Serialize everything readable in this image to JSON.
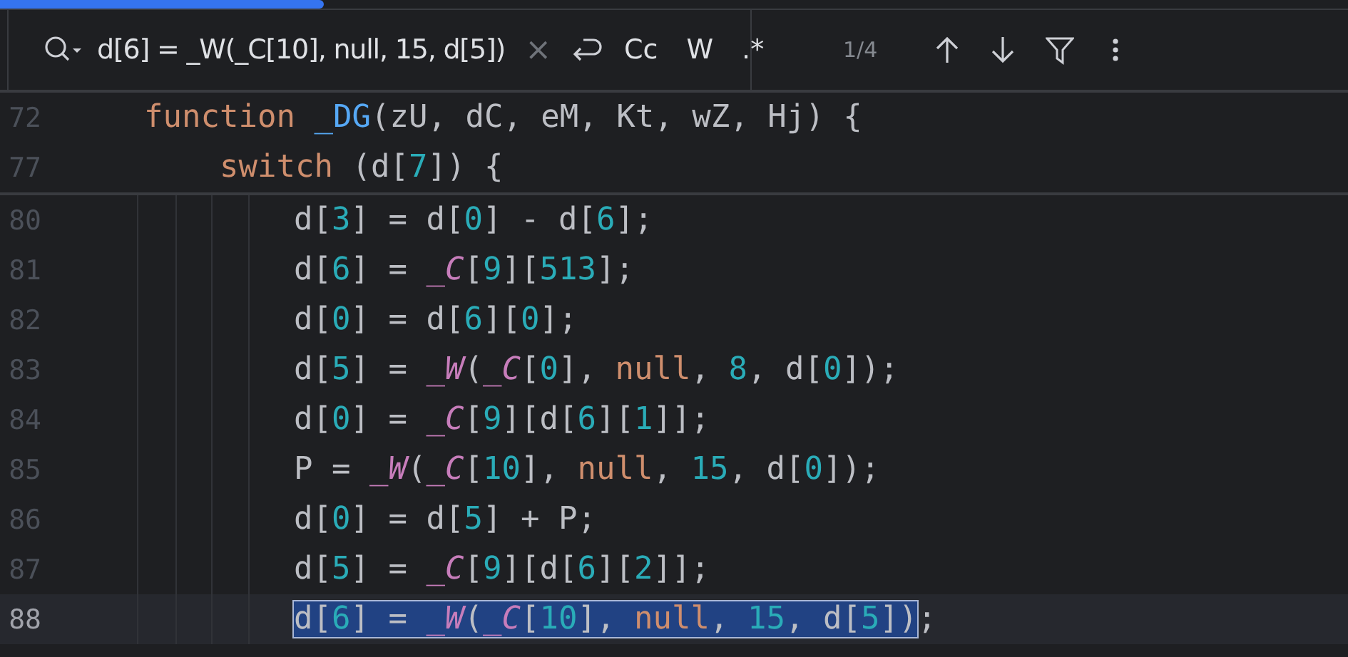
{
  "progress": {
    "level": 0.24
  },
  "search": {
    "query": "d[6] = _W(_C[10], null, 15, d[5])",
    "clear": "×",
    "options": [
      {
        "label": "Cc",
        "selected": false
      },
      {
        "label": "W",
        "selected": false
      },
      {
        "label": ".*",
        "selected": false
      }
    ],
    "count": "1/4"
  },
  "sticky_lines": [
    {
      "number": "72",
      "tokens": [
        {
          "kind": "keyword",
          "text": "function "
        },
        {
          "kind": "fn",
          "text": "_DG"
        },
        {
          "kind": "text",
          "text": "(zU, dC, eM, Kt, wZ, Hj) {"
        }
      ],
      "children": [
        {
          "number": "77",
          "tokens": [
            {
              "kind": "keyword",
              "text": "switch "
            },
            {
              "kind": "text",
              "text": "(d["
            },
            {
              "kind": "num",
              "text": "7"
            },
            {
              "kind": "text",
              "text": "]) {"
            }
          ]
        }
      ]
    }
  ],
  "lines": [
    {
      "number": "80",
      "current": false,
      "tokens": [
        {
          "kind": "text",
          "text": "d["
        },
        {
          "kind": "num",
          "text": "3"
        },
        {
          "kind": "text",
          "text": "] = d["
        },
        {
          "kind": "num",
          "text": "0"
        },
        {
          "kind": "text",
          "text": "] - d["
        },
        {
          "kind": "num",
          "text": "6"
        },
        {
          "kind": "text",
          "text": "];"
        }
      ]
    },
    {
      "number": "81",
      "current": false,
      "tokens": [
        {
          "kind": "text",
          "text": "d["
        },
        {
          "kind": "num",
          "text": "6"
        },
        {
          "kind": "text",
          "text": "] = "
        },
        {
          "kind": "global",
          "text": "_C"
        },
        {
          "kind": "text",
          "text": "["
        },
        {
          "kind": "num",
          "text": "9"
        },
        {
          "kind": "text",
          "text": "]["
        },
        {
          "kind": "num",
          "text": "513"
        },
        {
          "kind": "text",
          "text": "];"
        }
      ]
    },
    {
      "number": "82",
      "current": false,
      "tokens": [
        {
          "kind": "text",
          "text": "d["
        },
        {
          "kind": "num",
          "text": "0"
        },
        {
          "kind": "text",
          "text": "] = d["
        },
        {
          "kind": "num",
          "text": "6"
        },
        {
          "kind": "text",
          "text": "]["
        },
        {
          "kind": "num",
          "text": "0"
        },
        {
          "kind": "text",
          "text": "];"
        }
      ]
    },
    {
      "number": "83",
      "current": false,
      "tokens": [
        {
          "kind": "text",
          "text": "d["
        },
        {
          "kind": "num",
          "text": "5"
        },
        {
          "kind": "text",
          "text": "] = "
        },
        {
          "kind": "global",
          "text": "_W"
        },
        {
          "kind": "text",
          "text": "("
        },
        {
          "kind": "global",
          "text": "_C"
        },
        {
          "kind": "text",
          "text": "["
        },
        {
          "kind": "num",
          "text": "0"
        },
        {
          "kind": "text",
          "text": "], "
        },
        {
          "kind": "keyword",
          "text": "null"
        },
        {
          "kind": "text",
          "text": ", "
        },
        {
          "kind": "num",
          "text": "8"
        },
        {
          "kind": "text",
          "text": ", d["
        },
        {
          "kind": "num",
          "text": "0"
        },
        {
          "kind": "text",
          "text": "]);"
        }
      ]
    },
    {
      "number": "84",
      "current": false,
      "tokens": [
        {
          "kind": "text",
          "text": "d["
        },
        {
          "kind": "num",
          "text": "0"
        },
        {
          "kind": "text",
          "text": "] = "
        },
        {
          "kind": "global",
          "text": "_C"
        },
        {
          "kind": "text",
          "text": "["
        },
        {
          "kind": "num",
          "text": "9"
        },
        {
          "kind": "text",
          "text": "][d["
        },
        {
          "kind": "num",
          "text": "6"
        },
        {
          "kind": "text",
          "text": "]["
        },
        {
          "kind": "num",
          "text": "1"
        },
        {
          "kind": "text",
          "text": "]];"
        }
      ]
    },
    {
      "number": "85",
      "current": false,
      "tokens": [
        {
          "kind": "text",
          "text": "P = "
        },
        {
          "kind": "global",
          "text": "_W"
        },
        {
          "kind": "text",
          "text": "("
        },
        {
          "kind": "global",
          "text": "_C"
        },
        {
          "kind": "text",
          "text": "["
        },
        {
          "kind": "num",
          "text": "10"
        },
        {
          "kind": "text",
          "text": "], "
        },
        {
          "kind": "keyword",
          "text": "null"
        },
        {
          "kind": "text",
          "text": ", "
        },
        {
          "kind": "num",
          "text": "15"
        },
        {
          "kind": "text",
          "text": ", d["
        },
        {
          "kind": "num",
          "text": "0"
        },
        {
          "kind": "text",
          "text": "]);"
        }
      ]
    },
    {
      "number": "86",
      "current": false,
      "tokens": [
        {
          "kind": "text",
          "text": "d["
        },
        {
          "kind": "num",
          "text": "0"
        },
        {
          "kind": "text",
          "text": "] = d["
        },
        {
          "kind": "num",
          "text": "5"
        },
        {
          "kind": "text",
          "text": "] + P;"
        }
      ]
    },
    {
      "number": "87",
      "current": false,
      "tokens": [
        {
          "kind": "text",
          "text": "d["
        },
        {
          "kind": "num",
          "text": "5"
        },
        {
          "kind": "text",
          "text": "] = "
        },
        {
          "kind": "global",
          "text": "_C"
        },
        {
          "kind": "text",
          "text": "["
        },
        {
          "kind": "num",
          "text": "9"
        },
        {
          "kind": "text",
          "text": "][d["
        },
        {
          "kind": "num",
          "text": "6"
        },
        {
          "kind": "text",
          "text": "]["
        },
        {
          "kind": "num",
          "text": "2"
        },
        {
          "kind": "text",
          "text": "]];"
        }
      ]
    },
    {
      "number": "88",
      "current": true,
      "selection": [
        {
          "kind": "text",
          "text": "d["
        },
        {
          "kind": "num",
          "text": "6"
        },
        {
          "kind": "text",
          "text": "] = "
        },
        {
          "kind": "global",
          "text": "_W"
        },
        {
          "kind": "text",
          "text": "("
        },
        {
          "kind": "global",
          "text": "_C"
        },
        {
          "kind": "text",
          "text": "["
        },
        {
          "kind": "num",
          "text": "10"
        },
        {
          "kind": "text",
          "text": "], "
        },
        {
          "kind": "keyword",
          "text": "null"
        },
        {
          "kind": "text",
          "text": ", "
        },
        {
          "kind": "num",
          "text": "15"
        },
        {
          "kind": "text",
          "text": ", d["
        },
        {
          "kind": "num",
          "text": "5"
        },
        {
          "kind": "text",
          "text": "])"
        }
      ],
      "tokens": [
        {
          "kind": "text",
          "text": ";"
        }
      ]
    }
  ]
}
